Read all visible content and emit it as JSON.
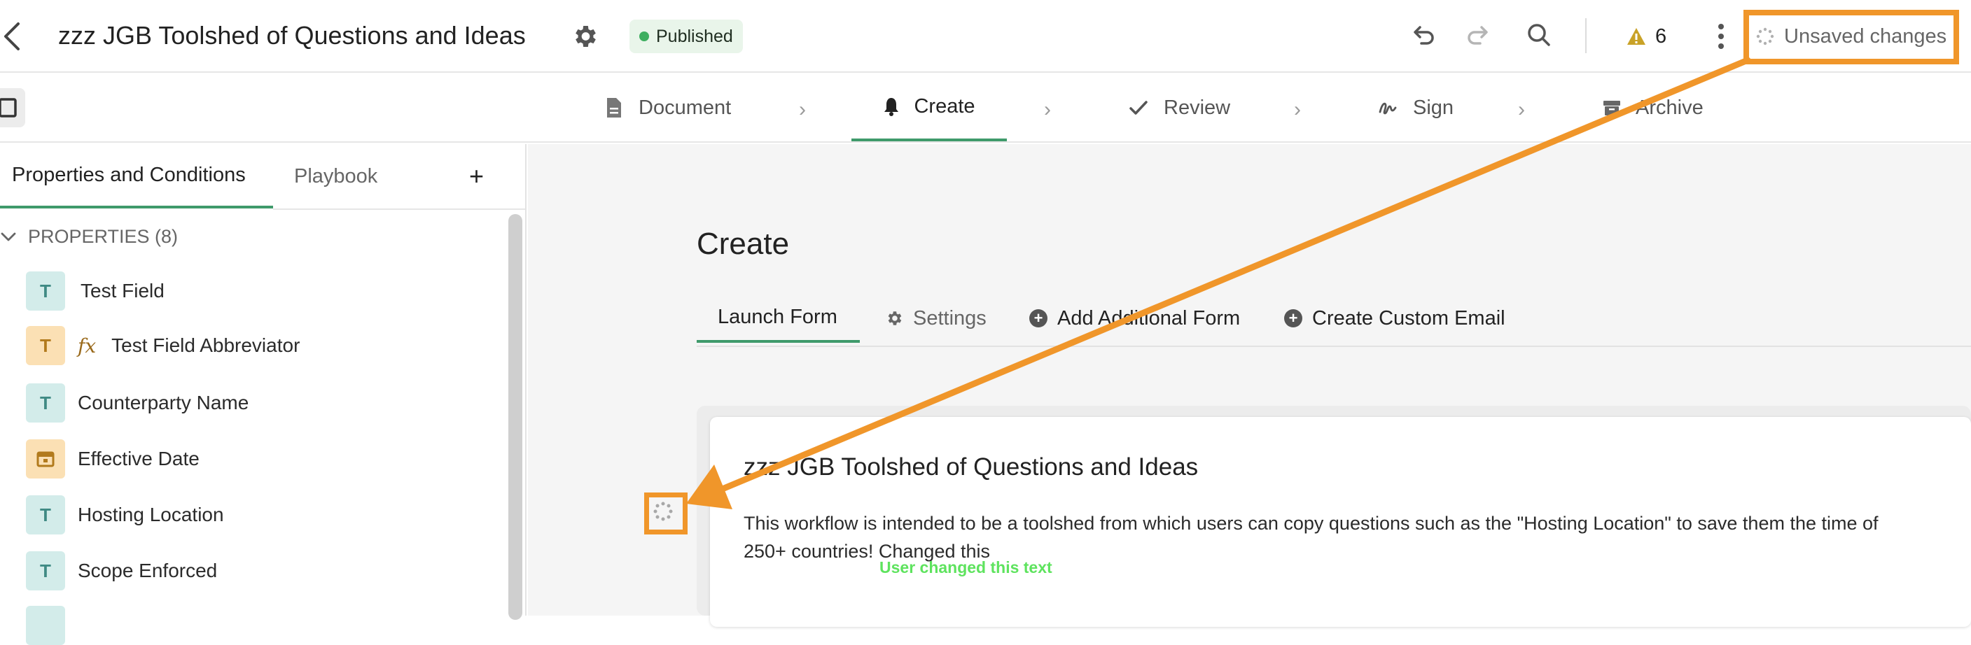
{
  "topbar": {
    "title": "zzz JGB Toolshed of Questions and Ideas",
    "status_badge": "Published",
    "warning_count": "6",
    "unsaved_label": "Unsaved changes"
  },
  "steps": [
    {
      "label": "Document"
    },
    {
      "label": "Create"
    },
    {
      "label": "Review"
    },
    {
      "label": "Sign"
    },
    {
      "label": "Archive"
    }
  ],
  "sidebar": {
    "tabs": [
      "Properties and Conditions",
      "Playbook"
    ],
    "add_label": "+",
    "section_title": "PROPERTIES (8)",
    "items": [
      {
        "label": "Test Field",
        "type": "T"
      },
      {
        "label": "Test Field Abbreviator",
        "type": "T",
        "formula": "fx"
      },
      {
        "label": "Counterparty Name",
        "type": "T"
      },
      {
        "label": "Effective Date",
        "type": "date"
      },
      {
        "label": "Hosting Location",
        "type": "T"
      },
      {
        "label": "Scope Enforced",
        "type": "T"
      }
    ]
  },
  "main": {
    "heading": "Create",
    "tabs": [
      "Launch Form",
      "Settings",
      "Add Additional Form",
      "Create Custom Email"
    ],
    "card": {
      "title": "zzz JGB Toolshed of Questions and Ideas",
      "body_line1": "This workflow is intended to be a toolshed from which users can copy questions such as the \"Hosting Location\" to save them the time of",
      "body_line2": "250+ countries! Changed this"
    }
  },
  "annotation": {
    "note": "User changed this text",
    "accent": "#f0962a",
    "note_color": "#5ee35e"
  }
}
